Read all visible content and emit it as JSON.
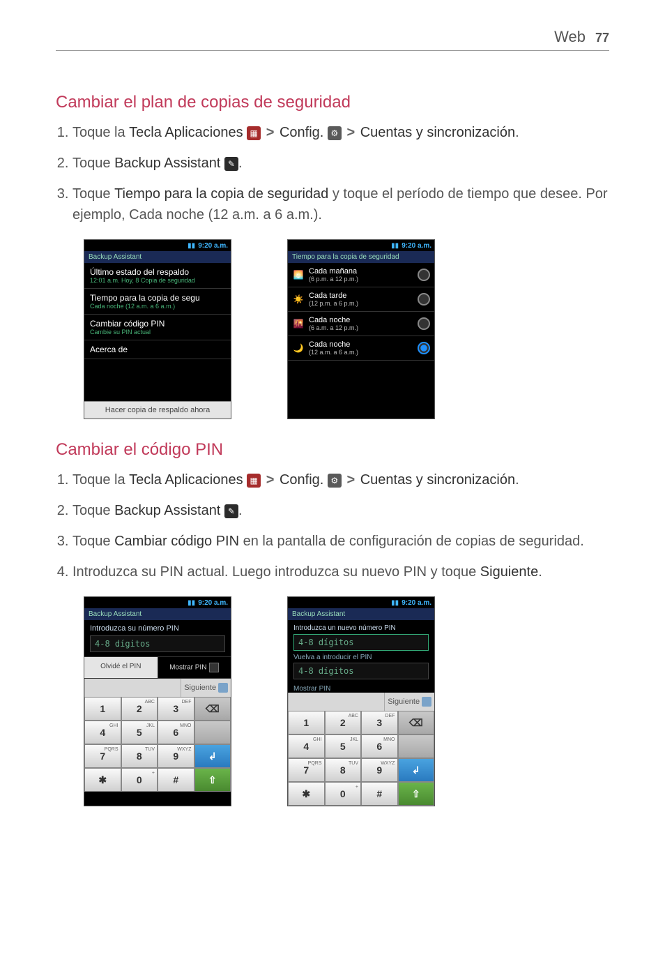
{
  "header": {
    "section": "Web",
    "page_number": "77"
  },
  "section1": {
    "heading": "Cambiar el plan de copias de seguridad",
    "steps": [
      {
        "pre": "Toque la ",
        "b1": "Tecla Aplicaciones",
        "mid1": " > ",
        "b2": "Config.",
        "mid2": " > ",
        "b3": "Cuentas y sincronización",
        "post": "."
      },
      {
        "pre": "Toque ",
        "b1": "Backup Assistant",
        "post": "."
      },
      {
        "pre": "Toque ",
        "b1": "Tiempo para la copia de seguridad",
        "post": " y toque el período de tiempo que desee. Por ejemplo, Cada noche (12 a.m. a 6 a.m.)."
      }
    ]
  },
  "phoneA": {
    "time": "9:20 a.m.",
    "title": "Backup Assistant",
    "items": [
      {
        "title": "Último estado del respaldo",
        "sub": "12:01 a.m. Hoy, 8 Copia de seguridad"
      },
      {
        "title": "Tiempo para la copia de segu",
        "sub": "Cada noche (12 a.m. a 6 a.m.)"
      },
      {
        "title": "Cambiar código PIN",
        "sub": "Cambie su PIN actual"
      },
      {
        "title": "Acerca de",
        "sub": ""
      }
    ],
    "button": "Hacer copia de respaldo ahora"
  },
  "phoneB": {
    "time": "9:20 a.m.",
    "title": "Tiempo para la copia de seguridad",
    "options": [
      {
        "icon": "🌅",
        "title": "Cada mañana",
        "sub": "(6 p.m. a 12 p.m.)",
        "selected": false
      },
      {
        "icon": "☀️",
        "title": "Cada tarde",
        "sub": "(12 p.m. a 6 p.m.)",
        "selected": false
      },
      {
        "icon": "🌇",
        "title": "Cada noche",
        "sub": "(6 a.m. a 12 p.m.)",
        "selected": false
      },
      {
        "icon": "🌙",
        "title": "Cada noche",
        "sub": "(12 a.m. a 6 a.m.)",
        "selected": true
      }
    ]
  },
  "section2": {
    "heading": "Cambiar el código PIN",
    "steps": [
      {
        "pre": "Toque la ",
        "b1": "Tecla Aplicaciones",
        "mid1": " > ",
        "b2": "Config.",
        "mid2": " > ",
        "b3": "Cuentas y sincronización",
        "post": "."
      },
      {
        "pre": "Toque ",
        "b1": "Backup Assistant",
        "post": "."
      },
      {
        "pre": "Toque ",
        "b1": "Cambiar código PIN",
        "post": " en la pantalla de configuración de copias de seguridad."
      },
      {
        "pre": "Introduzca su PIN actual. Luego introduzca su nuevo PIN y toque ",
        "b1": "Siguiente",
        "post": "."
      }
    ]
  },
  "phoneC": {
    "time": "9:20 a.m.",
    "title": "Backup Assistant",
    "prompt": "Introduzca su número PIN",
    "placeholder": "4-8 dígitos",
    "forgot": "Olvidé el PIN",
    "show": "Mostrar PIN",
    "next": "Siguiente"
  },
  "phoneD": {
    "time": "9:20 a.m.",
    "title": "Backup Assistant",
    "prompt1": "Introduzca un nuevo número PIN",
    "placeholder1": "4-8 dígitos",
    "prompt2": "Vuelva a introducir el PIN",
    "placeholder2": "4-8 dígitos",
    "show": "Mostrar PIN",
    "next": "Siguiente"
  },
  "keypad": {
    "keys": [
      {
        "t": "1",
        "s": ""
      },
      {
        "t": "2",
        "s": "ABC"
      },
      {
        "t": "3",
        "s": "DEF"
      },
      {
        "t": "",
        "s": "",
        "cls": "func del"
      },
      {
        "t": "4",
        "s": "GHI"
      },
      {
        "t": "5",
        "s": "JKL"
      },
      {
        "t": "6",
        "s": "MNO"
      },
      {
        "t": "",
        "s": "",
        "cls": "func"
      },
      {
        "t": "7",
        "s": "PQRS"
      },
      {
        "t": "8",
        "s": "TUV"
      },
      {
        "t": "9",
        "s": "WXYZ"
      },
      {
        "t": "",
        "s": "",
        "cls": "accent enter"
      },
      {
        "t": "✱",
        "s": ""
      },
      {
        "t": "0",
        "s": "+"
      },
      {
        "t": "#",
        "s": ""
      },
      {
        "t": "",
        "s": "",
        "cls": "green up"
      }
    ]
  }
}
